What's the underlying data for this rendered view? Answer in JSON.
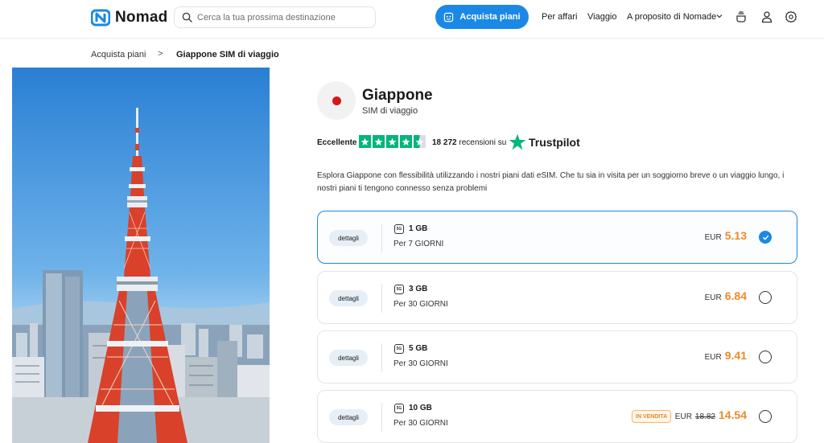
{
  "header": {
    "logo_text": "Nomad",
    "search_placeholder": "Cerca la tua prossima destinazione",
    "buy_button": "Acquista piani",
    "nav_business": "Per affari",
    "nav_travel": "Viaggio",
    "nav_about": "A proposito di Nomade",
    "icons": [
      "cup-icon",
      "user-icon",
      "gear-icon"
    ]
  },
  "breadcrumb": {
    "home": "Acquista piani",
    "separator": ">",
    "current": "Giappone SIM di viaggio"
  },
  "country": {
    "name": "Giappone",
    "subtitle": "SIM di viaggio",
    "flag_color": "#d21a1a"
  },
  "trustpilot": {
    "label": "Eccellente",
    "stars": 4.5,
    "count": "18 272",
    "count_suffix": "recensioni su",
    "brand": "Trustpilot"
  },
  "description": "Esplora Giappone con flessibilità utilizzando i nostri piani dati eSIM. Che tu sia in visita per un soggiorno breve o un viaggio lungo, i nostri piani ti tengono connesso senza problemi",
  "plans": [
    {
      "details": "dettagli",
      "network": "5G",
      "data": "1 GB",
      "days": "Per 7 GIORNI",
      "currency": "EUR",
      "price": "5.13",
      "selected": true
    },
    {
      "details": "dettagli",
      "network": "5G",
      "data": "3 GB",
      "days": "Per 30 GIORNI",
      "currency": "EUR",
      "price": "6.84",
      "selected": false
    },
    {
      "details": "dettagli",
      "network": "5G",
      "data": "5 GB",
      "days": "Per 30 GIORNI",
      "currency": "EUR",
      "price": "9.41",
      "selected": false
    },
    {
      "details": "dettagli",
      "network": "5G",
      "data": "10 GB",
      "days": "Per 30 GIORNI",
      "currency": "EUR",
      "old_price": "18.82",
      "price": "14.54",
      "sale_badge": "IN VENDITA",
      "selected": false
    }
  ],
  "colors": {
    "accent": "#1b88e6",
    "price": "#f08a24",
    "trustpilot_green": "#00b67a"
  }
}
